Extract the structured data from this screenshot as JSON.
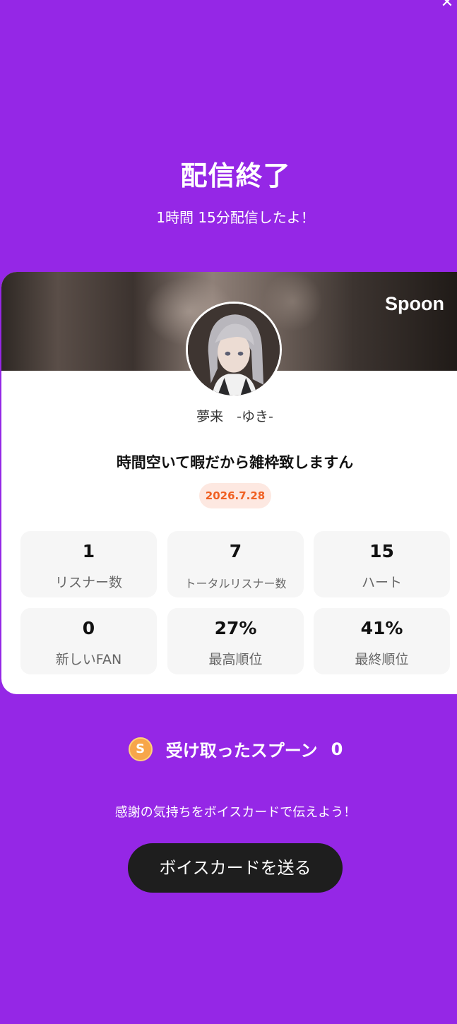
{
  "header": {
    "close_icon": "close-icon",
    "title": "配信終了",
    "subtitle": "1時間 15分配信したよ！"
  },
  "card": {
    "brand": "Spoon",
    "username": "夢来　-ゆき-",
    "stream_title": "時間空いて暇だから雑枠致しますん",
    "date": "2026.7.28",
    "stats": [
      {
        "value": "1",
        "label": "リスナー数"
      },
      {
        "value": "7",
        "label": "トータルリスナー数"
      },
      {
        "value": "15",
        "label": "ハート"
      },
      {
        "value": "0",
        "label": "新しいFAN"
      },
      {
        "value": "27%",
        "label": "最高順位"
      },
      {
        "value": "41%",
        "label": "最終順位"
      }
    ]
  },
  "spoons": {
    "coin_icon": "spoon-coin-icon",
    "coin_letter": "S",
    "label": "受け取ったスプーン",
    "count": "0"
  },
  "thanks_text": "感謝の気持ちをボイスカードで伝えよう！",
  "voice_card_button": "ボイスカードを送る",
  "colors": {
    "background": "#9527e6",
    "button": "#1e1e1e",
    "date_badge_bg": "#fde8e1",
    "date_badge_text": "#f06022",
    "coin": "#f7a64a"
  }
}
